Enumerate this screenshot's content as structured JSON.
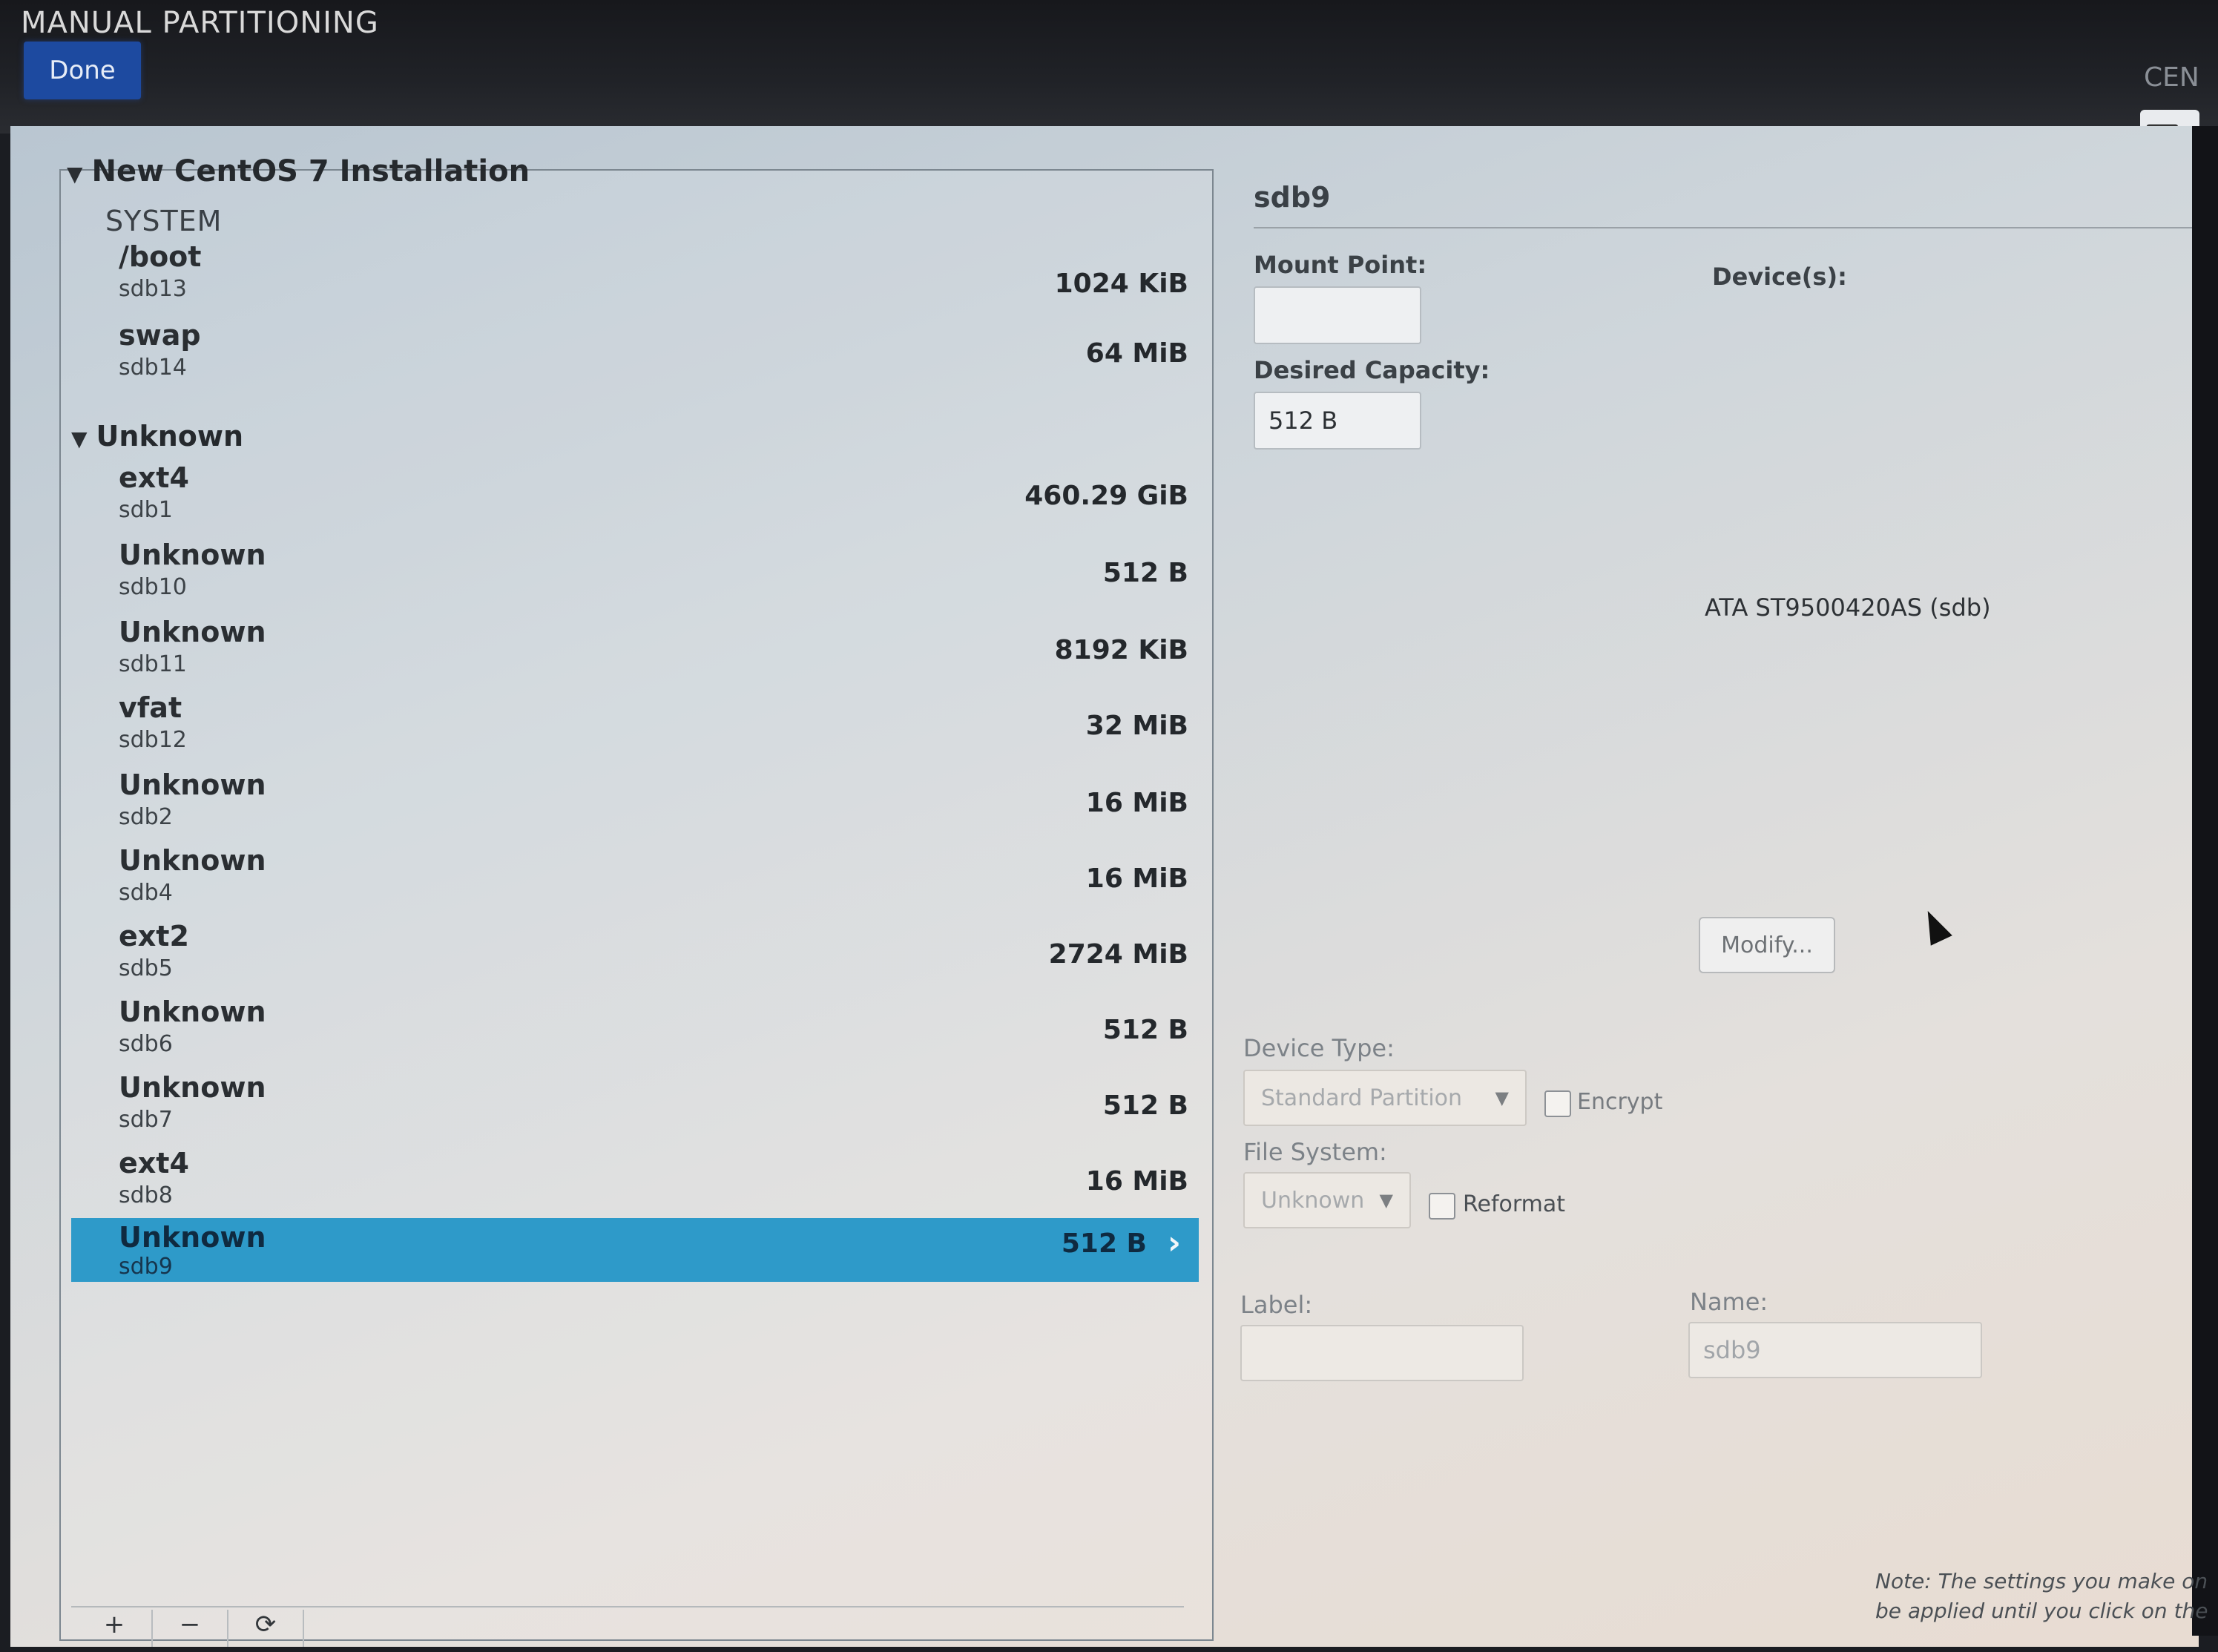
{
  "header": {
    "title": "MANUAL PARTITIONING",
    "done_label": "Done",
    "brand_partial": "CEN",
    "keyboard_partial": "u"
  },
  "left_pane": {
    "install_title": "New CentOS 7 Installation",
    "system_label": "SYSTEM",
    "system_items": [
      {
        "name": "/boot",
        "device": "sdb13",
        "size": "1024 KiB"
      },
      {
        "name": "swap",
        "device": "sdb14",
        "size": "64 MiB"
      }
    ],
    "unknown_label": "Unknown",
    "unknown_items": [
      {
        "name": "ext4",
        "device": "sdb1",
        "size": "460.29 GiB"
      },
      {
        "name": "Unknown",
        "device": "sdb10",
        "size": "512 B"
      },
      {
        "name": "Unknown",
        "device": "sdb11",
        "size": "8192 KiB"
      },
      {
        "name": "vfat",
        "device": "sdb12",
        "size": "32 MiB"
      },
      {
        "name": "Unknown",
        "device": "sdb2",
        "size": "16 MiB"
      },
      {
        "name": "Unknown",
        "device": "sdb4",
        "size": "16 MiB"
      },
      {
        "name": "ext2",
        "device": "sdb5",
        "size": "2724 MiB"
      },
      {
        "name": "Unknown",
        "device": "sdb6",
        "size": "512 B"
      },
      {
        "name": "Unknown",
        "device": "sdb7",
        "size": "512 B"
      },
      {
        "name": "ext4",
        "device": "sdb8",
        "size": "16 MiB"
      },
      {
        "name": "Unknown",
        "device": "sdb9",
        "size": "512 B",
        "selected": true
      }
    ],
    "bottom_buttons": [
      "+",
      "−",
      "⟳"
    ]
  },
  "details": {
    "title": "sdb9",
    "mount_point_label": "Mount Point:",
    "mount_point_value": "",
    "desired_capacity_label": "Desired Capacity:",
    "desired_capacity_value": "512 B",
    "devices_label": "Device(s):",
    "device_name": "ATA ST9500420AS (sdb)",
    "modify_label": "Modify...",
    "device_type_label": "Device Type:",
    "device_type_value": "Standard Partition",
    "encrypt_label": "Encrypt",
    "file_system_label": "File System:",
    "file_system_value": "Unknown",
    "reformat_label": "Reformat",
    "label_label": "Label:",
    "label_value": "",
    "name_label": "Name:",
    "name_value": "sdb9",
    "note_line1": "Note:  The settings you make on",
    "note_line2": "be applied until you click on the"
  },
  "colors": {
    "done_button": "#1d4aa0",
    "selection": "#2e9ac9"
  }
}
